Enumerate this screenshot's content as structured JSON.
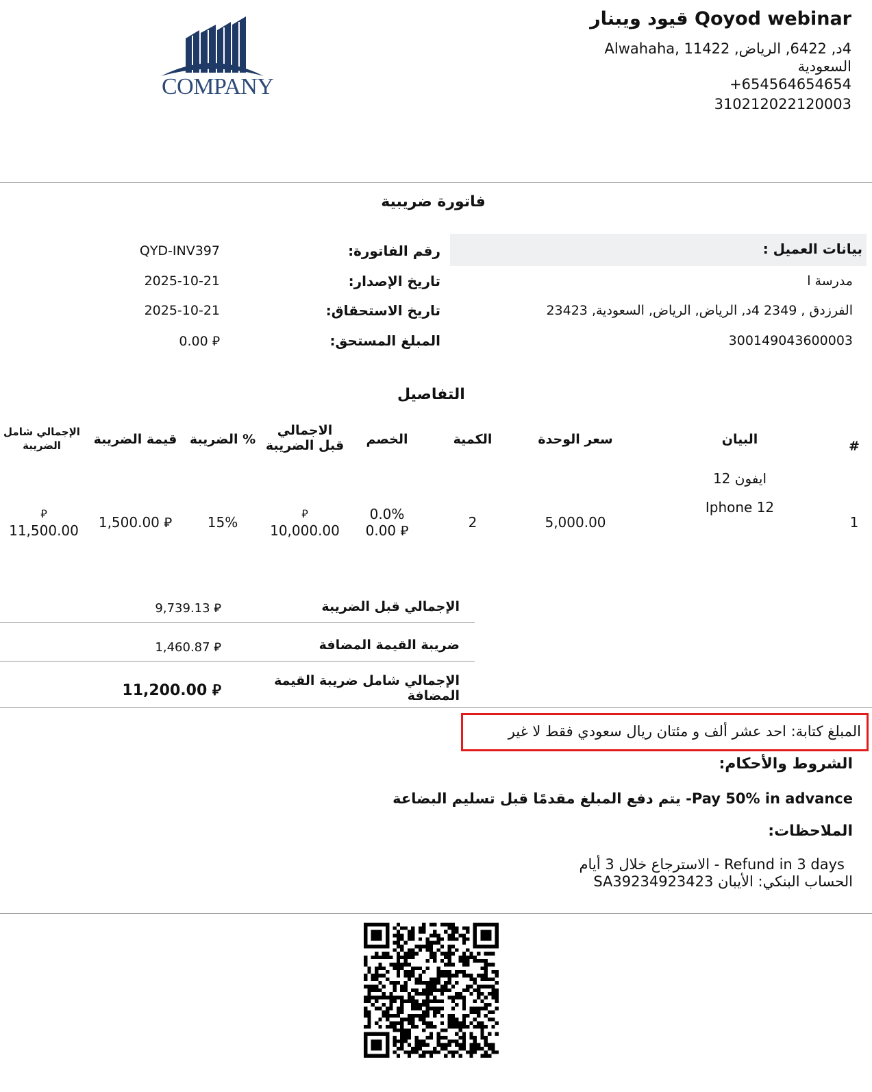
{
  "header": {
    "company_name": "Qoyod webinar قيود ويبنار",
    "address_line1": "4د, 6422, الرياض, Alwahaha, 11422",
    "address_line2": "السعودية",
    "phone": "+654564654654",
    "vat_number": "310212022120003",
    "logo_text": "COMPANY"
  },
  "title": "فاتورة ضريبية",
  "customer": {
    "header": "بيانات العميل :",
    "name": "مدرسة ا",
    "address": "الفرزدق , 2349 4د, الرياض, الرياض, السعودية, 23423",
    "vat_number": "300149043600003"
  },
  "meta": {
    "invoice_no_label": "رقم الفاتورة:",
    "invoice_no": "QYD-INV397",
    "issue_date_label": "تاريخ الإصدار:",
    "issue_date": "2025-10-21",
    "due_date_label": "تاريخ الاستحقاق:",
    "due_date": "2025-10-21",
    "amount_due_label": "المبلغ المستحق:",
    "amount_due": "0.00 ⃁"
  },
  "details": {
    "title": "التفاصيل",
    "columns": {
      "num": "#",
      "description": "البيان",
      "unit_price": "سعر الوحدة",
      "quantity": "الكمية",
      "discount": "الخصم",
      "subtotal_l1": "الاجمالي",
      "subtotal_l2": "قبل الضريبة",
      "tax_percent": "% الضريبة",
      "tax_amount": "قيمة الضريبة",
      "total_l1": "الإجمالي شامل",
      "total_l2": "الضريبة"
    },
    "rows": [
      {
        "num": "1",
        "desc_ar": "ايفون 12",
        "desc_en": "Iphone 12",
        "unit_price": "5,000.00",
        "quantity": "2",
        "discount_pct": "0.0%",
        "discount_amt": "0.00 ⃁",
        "subtotal_sym": "⃁",
        "subtotal": "10,000.00",
        "tax_percent": "15%",
        "tax_amount": "1,500.00 ⃁",
        "total_sym": "⃁",
        "total": "11,500.00"
      }
    ]
  },
  "totals": {
    "subtotal_label": "الإجمالي قبل الضريبة",
    "subtotal": "9,739.13 ⃁",
    "vat_label": "ضريبة القيمة المضافة",
    "vat": "1,460.87 ⃁",
    "grand_label_l1": "الإجمالي شامل ضريبة القيمة",
    "grand_label_l2": "المضافة",
    "grand_total": "11,200.00 ⃁"
  },
  "amount_words": "المبلغ كتابة:  احد عشر ألف و مئتان ريال سعودي فقط لا غير",
  "terms": {
    "title": "الشروط والأحكام:",
    "text": "Pay 50% in advance- يتم دفع المبلغ مقدمًا قبل تسليم البضاعة"
  },
  "notes": {
    "title": "الملاحظات:",
    "line1": "Refund in 3 days - الاسترجاع خلال 3 أيام",
    "line2": "الحساب البنكي: الأيبان SA39234923423"
  },
  "colors": {
    "logo_blue": "#1f3a66",
    "highlight_border": "#e41b1b",
    "customer_header_bg": "#eef0f2"
  }
}
